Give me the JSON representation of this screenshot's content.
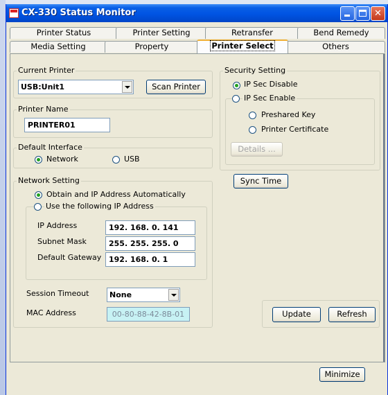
{
  "window": {
    "title": "CX-330 Status Monitor"
  },
  "tabs_row1": [
    "Printer Status",
    "Printer Setting",
    "Retransfer",
    "Bend Remedy"
  ],
  "tabs_row2": [
    "Media Setting",
    "Property",
    "Printer Select",
    "Others"
  ],
  "current_printer": {
    "label": "Current Printer",
    "value": "USB:Unit1",
    "scan_button": "Scan Printer"
  },
  "printer_name": {
    "label": "Printer Name",
    "value": "PRINTER01"
  },
  "default_interface": {
    "label": "Default Interface",
    "options": [
      "Network",
      "USB"
    ],
    "selected": "Network"
  },
  "network_setting": {
    "label": "Network Setting",
    "auto_option": "Obtain and IP Address Automatically",
    "manual_option": "Use the following IP Address",
    "ip_label": "IP Address",
    "ip_value": "192. 168. 0. 141",
    "subnet_label": "Subnet Mask",
    "subnet_value": "255. 255. 255. 0",
    "gateway_label": "Default Gateway",
    "gateway_value": "192. 168. 0. 1",
    "timeout_label": "Session Timeout",
    "timeout_value": "None",
    "mac_label": "MAC Address",
    "mac_value": "00-80-88-42-8B-01"
  },
  "security_setting": {
    "label": "Security Setting",
    "disable_option": "IP Sec Disable",
    "enable_option": "IP Sec Enable",
    "preshared_option": "Preshared Key",
    "certificate_option": "Printer Certificate",
    "details_button": "Details ...",
    "sync_button": "Sync Time"
  },
  "actions": {
    "update": "Update",
    "refresh": "Refresh",
    "minimize": "Minimize"
  }
}
